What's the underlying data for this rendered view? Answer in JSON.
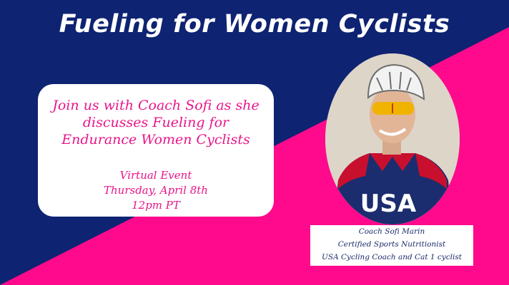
{
  "title": "Fueling for Women Cyclists",
  "colors": {
    "navy": "#0e2371",
    "pink": "#ff0a8c",
    "accent_text": "#e8168a"
  },
  "info_card": {
    "intro_lines": [
      "Join us with Coach Sofi as she",
      "discusses Fueling for",
      "Endurance Women Cyclists"
    ],
    "event_lines": [
      "Virtual Event",
      "Thursday, April 8th",
      "12pm PT"
    ]
  },
  "presenter": {
    "jersey_text": "USA",
    "caption_lines": [
      "Coach Sofi Marin",
      "Certified Sports Nutritionist",
      "USA Cycling Coach and Cat 1 cyclist"
    ]
  }
}
